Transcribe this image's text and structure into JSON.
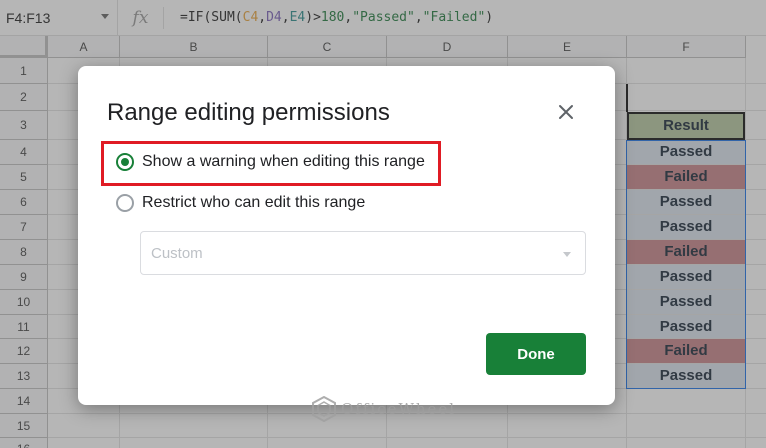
{
  "formula_bar": {
    "name_box": "F4:F13",
    "fx": "fx",
    "formula_parts": [
      "=IF(SUM(",
      "C4",
      ",",
      "D4",
      ",",
      "E4",
      ")>",
      "180",
      ",",
      "\"Passed\"",
      ",",
      "\"Failed\"",
      ")"
    ]
  },
  "columns": [
    "A",
    "B",
    "C",
    "D",
    "E",
    "F"
  ],
  "rows": [
    "1",
    "2",
    "3",
    "4",
    "5",
    "6",
    "7",
    "8",
    "9",
    "10",
    "11",
    "12",
    "13",
    "14",
    "15",
    "16"
  ],
  "results": {
    "header": "Result",
    "values": [
      "Passed",
      "Failed",
      "Passed",
      "Passed",
      "Failed",
      "Passed",
      "Passed",
      "Passed",
      "Failed",
      "Passed"
    ]
  },
  "dialog": {
    "title": "Range editing permissions",
    "option_warning": "Show a warning when editing this range",
    "option_restrict": "Restrict who can edit this range",
    "select_value": "Custom",
    "done_label": "Done"
  },
  "watermark": "OfficeWheel",
  "colors": {
    "accent_green": "#188038",
    "highlight_red": "#e01b24",
    "passed_fill": "#dbe3ee",
    "failed_fill": "#c9858a",
    "header_fill": "#b7c9a1"
  }
}
